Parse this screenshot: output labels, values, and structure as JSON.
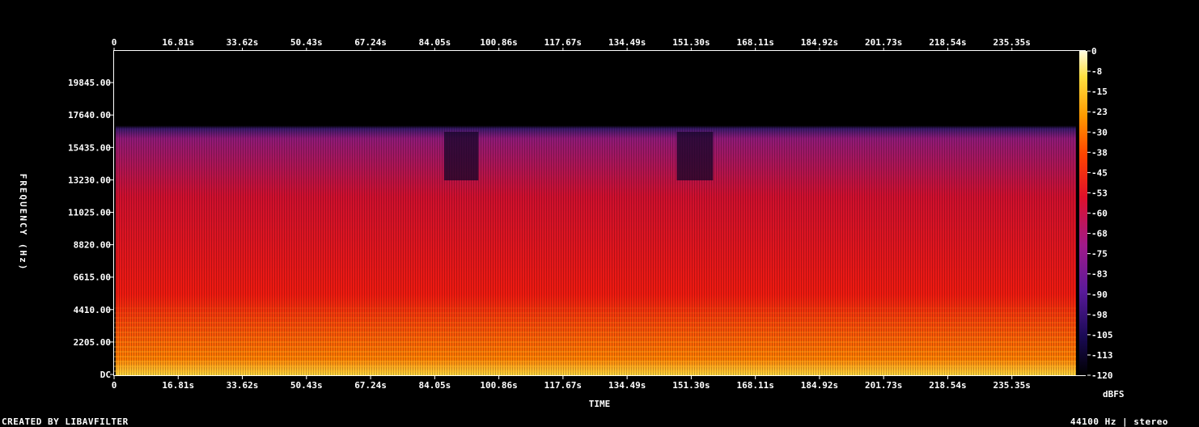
{
  "chart_data": {
    "type": "heatmap",
    "title": "",
    "xlabel": "TIME",
    "ylabel": "FREQUENCY (Hz)",
    "x_ticks": [
      "0",
      "16.81s",
      "33.62s",
      "50.43s",
      "67.24s",
      "84.05s",
      "100.86s",
      "117.67s",
      "134.49s",
      "151.30s",
      "168.11s",
      "184.92s",
      "201.73s",
      "218.54s",
      "235.35s"
    ],
    "y_ticks": [
      "DC",
      "2205.00",
      "4410.00",
      "6615.00",
      "8820.00",
      "11025.00",
      "13230.00",
      "15435.00",
      "17640.00",
      "19845.00"
    ],
    "xlim": [
      0,
      252.15
    ],
    "ylim": [
      0,
      22050
    ],
    "frequency_cutoff_hz": 16000,
    "quiet_segments": [
      [
        86.5,
        95.5
      ],
      [
        147.5,
        157.0
      ]
    ],
    "colorbar": {
      "label": "dBFS",
      "ticks": [
        "0",
        "-8",
        "-15",
        "-23",
        "-30",
        "-38",
        "-45",
        "-53",
        "-60",
        "-68",
        "-75",
        "-83",
        "-90",
        "-98",
        "-105",
        "-113",
        "-120"
      ],
      "range": [
        -120,
        0
      ],
      "colors": [
        "#000000",
        "#1a0a55",
        "#5a1a9a",
        "#a01a8a",
        "#e0102a",
        "#ff4400",
        "#ff9a00",
        "#ffe040",
        "#fffbe0"
      ]
    }
  },
  "footer": {
    "left": "CREATED BY LIBAVFILTER",
    "right": "44100 Hz | stereo"
  }
}
